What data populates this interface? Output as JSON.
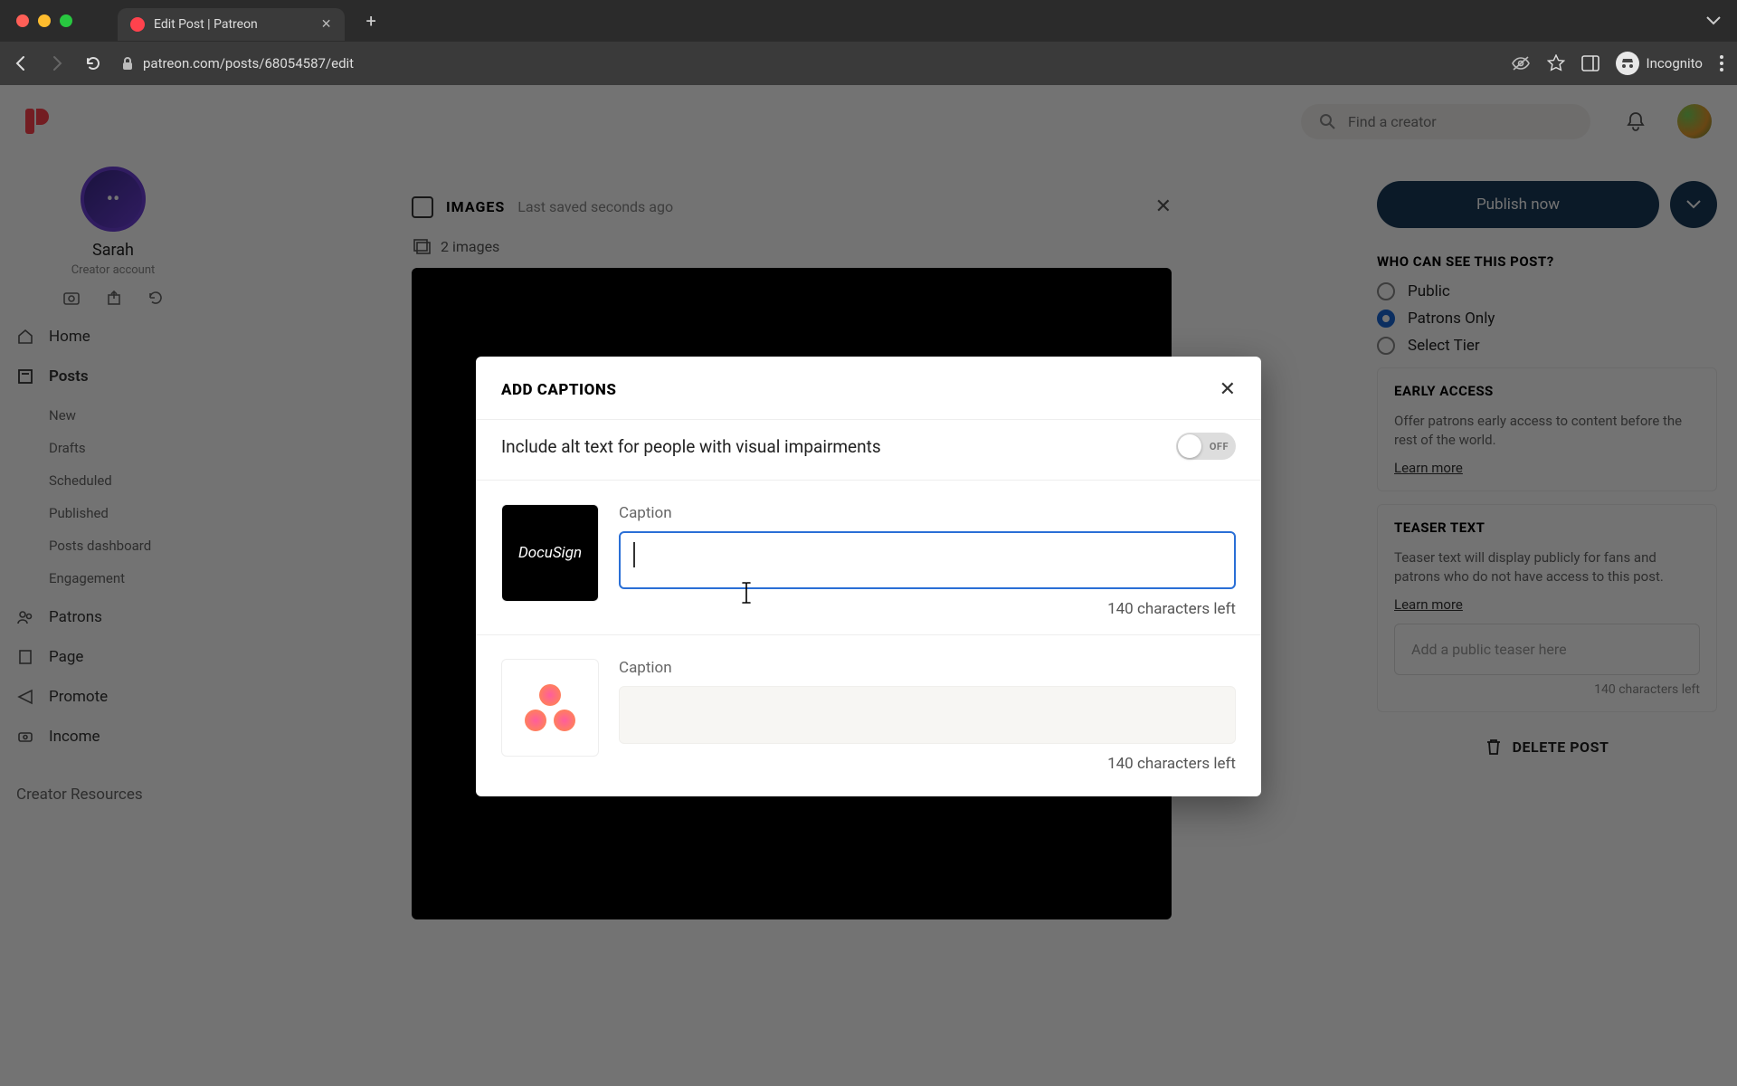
{
  "browser": {
    "tab_title": "Edit Post | Patreon",
    "url": "patreon.com/posts/68054587/edit",
    "incognito_label": "Incognito"
  },
  "topbar": {
    "search_placeholder": "Find a creator"
  },
  "profile": {
    "name": "Sarah",
    "subtitle": "Creator account"
  },
  "nav": {
    "home": "Home",
    "posts": "Posts",
    "sub_new": "New",
    "sub_drafts": "Drafts",
    "sub_scheduled": "Scheduled",
    "sub_published": "Published",
    "sub_dashboard": "Posts dashboard",
    "sub_engagement": "Engagement",
    "patrons": "Patrons",
    "page": "Page",
    "promote": "Promote",
    "income": "Income",
    "resources": "Creator Resources"
  },
  "post": {
    "type_label": "IMAGES",
    "saved": "Last saved seconds ago",
    "image_count": "2 images"
  },
  "publish": {
    "button": "Publish now"
  },
  "visibility": {
    "heading": "WHO CAN SEE THIS POST?",
    "opt_public": "Public",
    "opt_patrons": "Patrons Only",
    "opt_select": "Select Tier"
  },
  "early": {
    "heading": "EARLY ACCESS",
    "desc": "Offer patrons early access to content before the rest of the world.",
    "learn": "Learn more"
  },
  "teaser": {
    "heading": "TEASER TEXT",
    "desc": "Teaser text will display publicly for fans and patrons who do not have access to this post.",
    "learn": "Learn more",
    "placeholder": "Add a public teaser here",
    "chars": "140 characters left"
  },
  "delete_label": "DELETE POST",
  "modal": {
    "title": "ADD CAPTIONS",
    "alt_toggle_label": "Include alt text for people with visual impairments",
    "toggle_state": "OFF",
    "caption_label_1": "Caption",
    "caption_label_2": "Caption",
    "thumb1_text": "DocuSign",
    "chars_left_1": "140 characters left",
    "chars_left_2": "140 characters left"
  }
}
